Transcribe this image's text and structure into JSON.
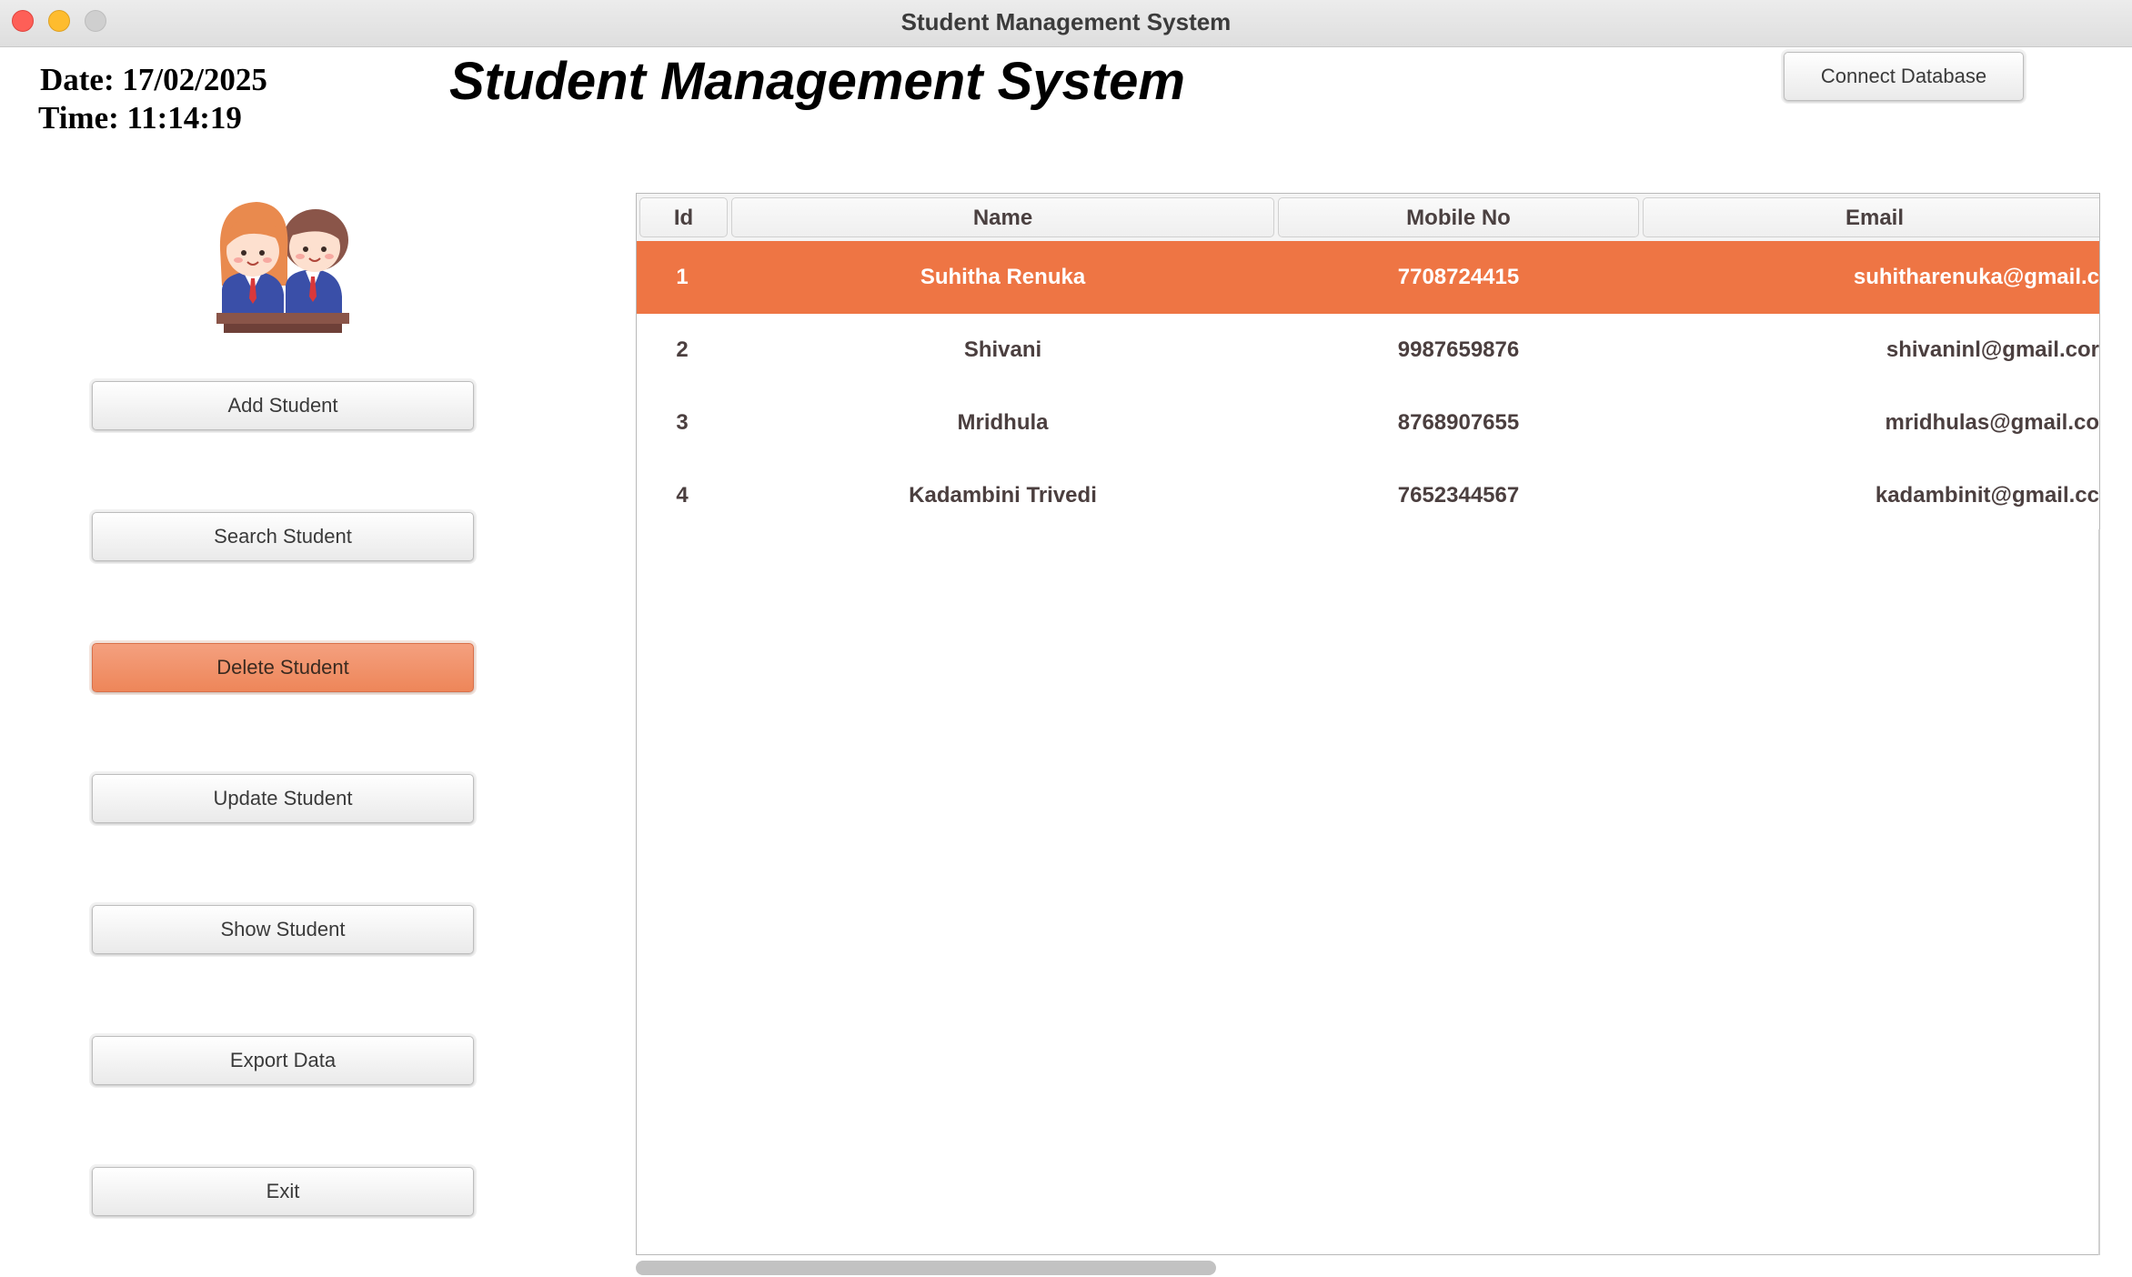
{
  "window": {
    "title": "Student Management System"
  },
  "header": {
    "date_text": "Date: 17/02/2025",
    "time_text": "Time: 11:14:19",
    "heading": "Student Management System",
    "connect_label": "Connect Database"
  },
  "sidebar": {
    "avatar_icon": "students-avatar-icon",
    "items": [
      {
        "label": "Add Student"
      },
      {
        "label": "Search Student"
      },
      {
        "label": "Delete Student",
        "active": true
      },
      {
        "label": "Update Student"
      },
      {
        "label": "Show Student"
      },
      {
        "label": "Export Data"
      },
      {
        "label": "Exit"
      }
    ]
  },
  "table": {
    "columns": [
      "Id",
      "Name",
      "Mobile No",
      "Email"
    ],
    "rows": [
      {
        "id": "1",
        "name": "Suhitha Renuka",
        "mobile": "7708724415",
        "email": "suhitharenuka@gmail.c",
        "selected": true
      },
      {
        "id": "2",
        "name": "Shivani",
        "mobile": "9987659876",
        "email": "shivaninl@gmail.cor"
      },
      {
        "id": "3",
        "name": "Mridhula",
        "mobile": "8768907655",
        "email": "mridhulas@gmail.co"
      },
      {
        "id": "4",
        "name": "Kadambini Trivedi",
        "mobile": "7652344567",
        "email": "kadambinit@gmail.cc"
      }
    ]
  },
  "colors": {
    "accent": "#ee7544",
    "active_button": "#ee8659"
  }
}
